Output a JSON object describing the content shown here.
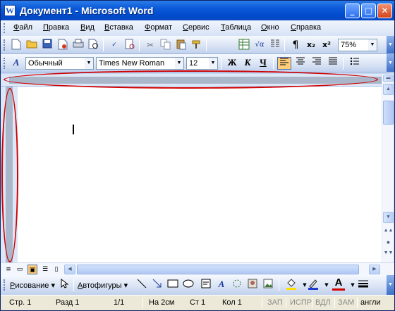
{
  "window": {
    "title": "Документ1 - Microsoft Word",
    "app_icon": "W",
    "controls": {
      "minimize": "_",
      "maximize": "□",
      "close": "✕"
    }
  },
  "menubar": {
    "items": [
      "Файл",
      "Правка",
      "Вид",
      "Вставка",
      "Формат",
      "Сервис",
      "Таблица",
      "Окно",
      "Справка"
    ]
  },
  "standard_toolbar": {
    "zoom": "75%",
    "icons": [
      "new-document-icon",
      "open-icon",
      "save-icon",
      "permission-icon",
      "print-icon",
      "print-preview-icon",
      "spelling-icon",
      "research-icon",
      "cut-icon",
      "copy-icon",
      "paste-icon",
      "format-painter-icon",
      "insert-table-icon",
      "insert-excel-icon",
      "columns-icon",
      "show-formatting-icon",
      "subscript-icon",
      "superscript-icon"
    ],
    "labels": {
      "formula": "√α",
      "pilcrow": "¶",
      "subscript": "x₂",
      "superscript": "x²"
    }
  },
  "formatting_toolbar": {
    "style": "Обычный",
    "font": "Times New Roman",
    "size": "12",
    "bold": "Ж",
    "italic": "К",
    "underline": "Ч"
  },
  "drawing_toolbar": {
    "draw_menu": "Рисование",
    "autoshapes_menu": "Автофигуры",
    "text_color_letter": "A"
  },
  "statusbar": {
    "page": "Стр. 1",
    "section": "Разд 1",
    "pages": "1/1",
    "at": "На 2см",
    "line": "Ст 1",
    "col": "Кол 1",
    "rec": "ЗАП",
    "trk": "ИСПР",
    "ext": "ВДЛ",
    "ovr": "ЗАМ",
    "language": "англи"
  },
  "colors": {
    "title_bar": "#0a58d8",
    "toolbar_bg": "#d2def2",
    "highlight_ring": "#d00000",
    "ruler": "#aab7cb",
    "active_button": "#ffce7a"
  }
}
